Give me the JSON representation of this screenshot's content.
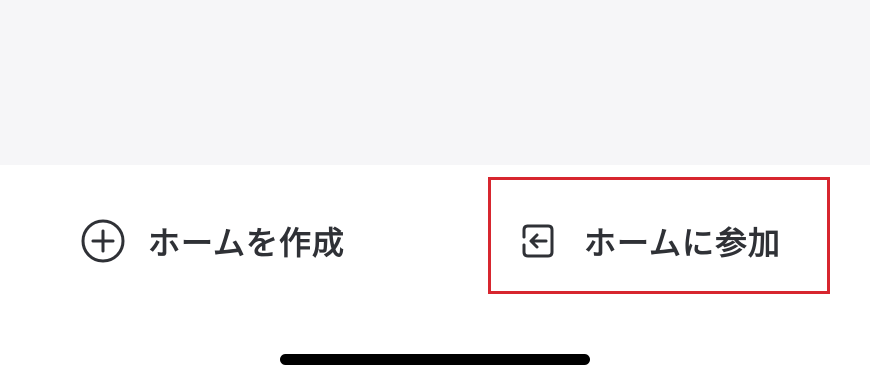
{
  "actions": {
    "create_home": {
      "label": "ホームを作成",
      "icon": "plus-circle-icon"
    },
    "join_home": {
      "label": "ホームに参加",
      "icon": "enter-arrow-icon"
    }
  },
  "colors": {
    "top_background": "#f6f6f8",
    "text": "#2f3136",
    "highlight": "#d7262f",
    "home_indicator": "#000000"
  }
}
